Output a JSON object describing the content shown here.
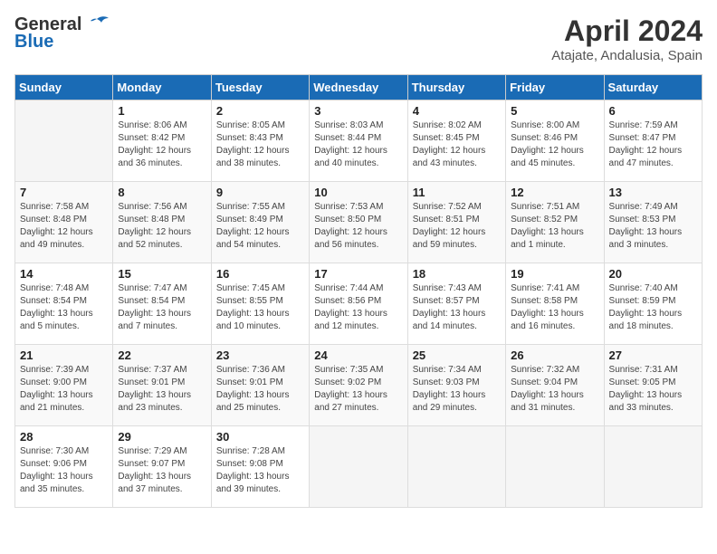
{
  "logo": {
    "general": "General",
    "blue": "Blue"
  },
  "title": "April 2024",
  "location": "Atajate, Andalusia, Spain",
  "days_header": [
    "Sunday",
    "Monday",
    "Tuesday",
    "Wednesday",
    "Thursday",
    "Friday",
    "Saturday"
  ],
  "weeks": [
    [
      {
        "day": "",
        "info": ""
      },
      {
        "day": "1",
        "info": "Sunrise: 8:06 AM\nSunset: 8:42 PM\nDaylight: 12 hours\nand 36 minutes."
      },
      {
        "day": "2",
        "info": "Sunrise: 8:05 AM\nSunset: 8:43 PM\nDaylight: 12 hours\nand 38 minutes."
      },
      {
        "day": "3",
        "info": "Sunrise: 8:03 AM\nSunset: 8:44 PM\nDaylight: 12 hours\nand 40 minutes."
      },
      {
        "day": "4",
        "info": "Sunrise: 8:02 AM\nSunset: 8:45 PM\nDaylight: 12 hours\nand 43 minutes."
      },
      {
        "day": "5",
        "info": "Sunrise: 8:00 AM\nSunset: 8:46 PM\nDaylight: 12 hours\nand 45 minutes."
      },
      {
        "day": "6",
        "info": "Sunrise: 7:59 AM\nSunset: 8:47 PM\nDaylight: 12 hours\nand 47 minutes."
      }
    ],
    [
      {
        "day": "7",
        "info": "Sunrise: 7:58 AM\nSunset: 8:48 PM\nDaylight: 12 hours\nand 49 minutes."
      },
      {
        "day": "8",
        "info": "Sunrise: 7:56 AM\nSunset: 8:48 PM\nDaylight: 12 hours\nand 52 minutes."
      },
      {
        "day": "9",
        "info": "Sunrise: 7:55 AM\nSunset: 8:49 PM\nDaylight: 12 hours\nand 54 minutes."
      },
      {
        "day": "10",
        "info": "Sunrise: 7:53 AM\nSunset: 8:50 PM\nDaylight: 12 hours\nand 56 minutes."
      },
      {
        "day": "11",
        "info": "Sunrise: 7:52 AM\nSunset: 8:51 PM\nDaylight: 12 hours\nand 59 minutes."
      },
      {
        "day": "12",
        "info": "Sunrise: 7:51 AM\nSunset: 8:52 PM\nDaylight: 13 hours\nand 1 minute."
      },
      {
        "day": "13",
        "info": "Sunrise: 7:49 AM\nSunset: 8:53 PM\nDaylight: 13 hours\nand 3 minutes."
      }
    ],
    [
      {
        "day": "14",
        "info": "Sunrise: 7:48 AM\nSunset: 8:54 PM\nDaylight: 13 hours\nand 5 minutes."
      },
      {
        "day": "15",
        "info": "Sunrise: 7:47 AM\nSunset: 8:54 PM\nDaylight: 13 hours\nand 7 minutes."
      },
      {
        "day": "16",
        "info": "Sunrise: 7:45 AM\nSunset: 8:55 PM\nDaylight: 13 hours\nand 10 minutes."
      },
      {
        "day": "17",
        "info": "Sunrise: 7:44 AM\nSunset: 8:56 PM\nDaylight: 13 hours\nand 12 minutes."
      },
      {
        "day": "18",
        "info": "Sunrise: 7:43 AM\nSunset: 8:57 PM\nDaylight: 13 hours\nand 14 minutes."
      },
      {
        "day": "19",
        "info": "Sunrise: 7:41 AM\nSunset: 8:58 PM\nDaylight: 13 hours\nand 16 minutes."
      },
      {
        "day": "20",
        "info": "Sunrise: 7:40 AM\nSunset: 8:59 PM\nDaylight: 13 hours\nand 18 minutes."
      }
    ],
    [
      {
        "day": "21",
        "info": "Sunrise: 7:39 AM\nSunset: 9:00 PM\nDaylight: 13 hours\nand 21 minutes."
      },
      {
        "day": "22",
        "info": "Sunrise: 7:37 AM\nSunset: 9:01 PM\nDaylight: 13 hours\nand 23 minutes."
      },
      {
        "day": "23",
        "info": "Sunrise: 7:36 AM\nSunset: 9:01 PM\nDaylight: 13 hours\nand 25 minutes."
      },
      {
        "day": "24",
        "info": "Sunrise: 7:35 AM\nSunset: 9:02 PM\nDaylight: 13 hours\nand 27 minutes."
      },
      {
        "day": "25",
        "info": "Sunrise: 7:34 AM\nSunset: 9:03 PM\nDaylight: 13 hours\nand 29 minutes."
      },
      {
        "day": "26",
        "info": "Sunrise: 7:32 AM\nSunset: 9:04 PM\nDaylight: 13 hours\nand 31 minutes."
      },
      {
        "day": "27",
        "info": "Sunrise: 7:31 AM\nSunset: 9:05 PM\nDaylight: 13 hours\nand 33 minutes."
      }
    ],
    [
      {
        "day": "28",
        "info": "Sunrise: 7:30 AM\nSunset: 9:06 PM\nDaylight: 13 hours\nand 35 minutes."
      },
      {
        "day": "29",
        "info": "Sunrise: 7:29 AM\nSunset: 9:07 PM\nDaylight: 13 hours\nand 37 minutes."
      },
      {
        "day": "30",
        "info": "Sunrise: 7:28 AM\nSunset: 9:08 PM\nDaylight: 13 hours\nand 39 minutes."
      },
      {
        "day": "",
        "info": ""
      },
      {
        "day": "",
        "info": ""
      },
      {
        "day": "",
        "info": ""
      },
      {
        "day": "",
        "info": ""
      }
    ]
  ]
}
